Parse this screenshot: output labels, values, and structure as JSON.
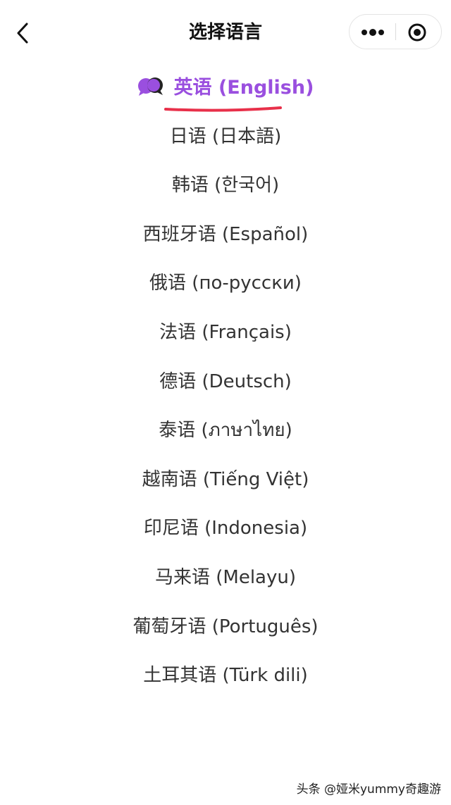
{
  "nav": {
    "title": "选择语言",
    "back_icon": "chevron-left-icon",
    "more_icon": "more-dots-icon",
    "close_icon": "target-circle-icon"
  },
  "languages": [
    {
      "label": "英语 (English)",
      "selected": true
    },
    {
      "label": "日语 (日本語)",
      "selected": false
    },
    {
      "label": "韩语 (한국어)",
      "selected": false
    },
    {
      "label": "西班牙语 (Español)",
      "selected": false
    },
    {
      "label": "俄语 (по-русски)",
      "selected": false
    },
    {
      "label": "法语 (Français)",
      "selected": false
    },
    {
      "label": "德语 (Deutsch)",
      "selected": false
    },
    {
      "label": "泰语 (ภาษาไทย)",
      "selected": false
    },
    {
      "label": "越南语 (Tiếng Việt)",
      "selected": false
    },
    {
      "label": "印尼语 (Indonesia)",
      "selected": false
    },
    {
      "label": "马来语 (Melayu)",
      "selected": false
    },
    {
      "label": "葡萄牙语 (Português)",
      "selected": false
    },
    {
      "label": "土耳其语 (Türk dili)",
      "selected": false
    }
  ],
  "selected_icon": "speech-bubbles-icon",
  "colors": {
    "accent": "#9a4fdf",
    "annotation_underline": "#e8304a"
  },
  "watermark": "头条 @娅米yummy奇趣游"
}
